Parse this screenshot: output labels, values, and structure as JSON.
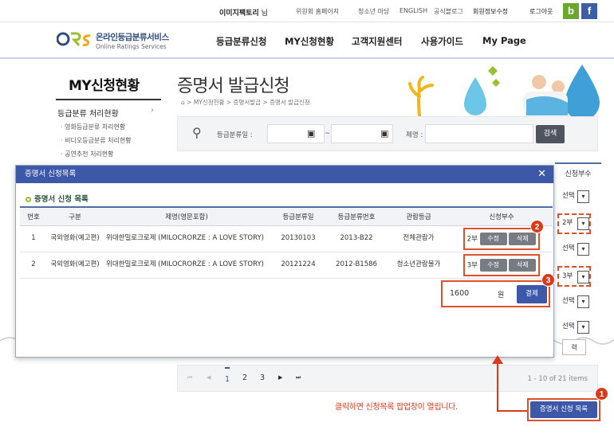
{
  "topbar": {
    "user_name": "이미지팩토리",
    "user_suffix": "님",
    "links": [
      "위원회 홈페이지",
      "청소년 마당",
      "ENGLISH",
      "공식블로그"
    ],
    "member_edit": "회원정보수정",
    "logout": "로그아웃",
    "blog_icon": "b",
    "facebook_icon": "f",
    "colors": {
      "blog": "#6aa82c",
      "facebook": "#3b5fa7"
    }
  },
  "header": {
    "logo_ko": "온라인등급분류서비스",
    "logo_en": "Online Ratings Services",
    "nav": [
      "등급분류신청",
      "MY신청현황",
      "고객지원센터",
      "사용가이드",
      "My Page"
    ]
  },
  "sidebar": {
    "title": "MY신청현황",
    "main_item": "등급분류 처리현황",
    "sub_items": [
      "영화등급분류 처리현황",
      "비디오등급분류 처리현황",
      "공연추천 처리현황"
    ]
  },
  "page": {
    "title": "증명서 발급신청",
    "breadcrumb": "> MY신청현황 > 증명서발급 > 증명서 발급신청"
  },
  "search": {
    "date_label": "등급분류일 :",
    "tilde": "~",
    "title_label": "제명 :",
    "button": "검색"
  },
  "background_table": {
    "header": "신청부수",
    "selects": [
      "선택",
      "2부",
      "선택",
      "3부",
      "선택",
      "선택"
    ],
    "peek_button": "력"
  },
  "modal": {
    "title": "증명서 신청목록",
    "close": "✕",
    "subtitle": "증명서 신청 목록",
    "columns": [
      "번호",
      "구분",
      "제명(영문포함)",
      "등급분류일",
      "등급분류번호",
      "관람등급",
      "신청부수"
    ],
    "rows": [
      {
        "no": "1",
        "type": "국외영화(예고편)",
        "title": "위대한밀로크로제 (MILOCRORZE : A LOVE STORY)",
        "date": "20130103",
        "code": "2013-B22",
        "rating": "전체관람가",
        "copies": "2부",
        "edit": "수정",
        "delete": "삭제"
      },
      {
        "no": "2",
        "type": "국외영화(예고편)",
        "title": "위대한밀로크로제 (MILOCRORZE : A LOVE STORY)",
        "date": "20121224",
        "code": "2012-B1586",
        "rating": "청소년관람불가",
        "copies": "3부",
        "edit": "수정",
        "delete": "삭제"
      }
    ],
    "price": "1600",
    "currency": "원",
    "pay_button": "결제"
  },
  "pager": {
    "first": "⏮",
    "prev": "◀",
    "pages": [
      "1",
      "2",
      "3"
    ],
    "next": "▶",
    "last": "⏭",
    "info": "1 - 10 of 21 items"
  },
  "callout": {
    "badges": [
      "1",
      "2",
      "3"
    ],
    "note": "클릭하면 신청목록 팝업창이 열립니다.",
    "cta_button": "증명서 신청 목록"
  }
}
